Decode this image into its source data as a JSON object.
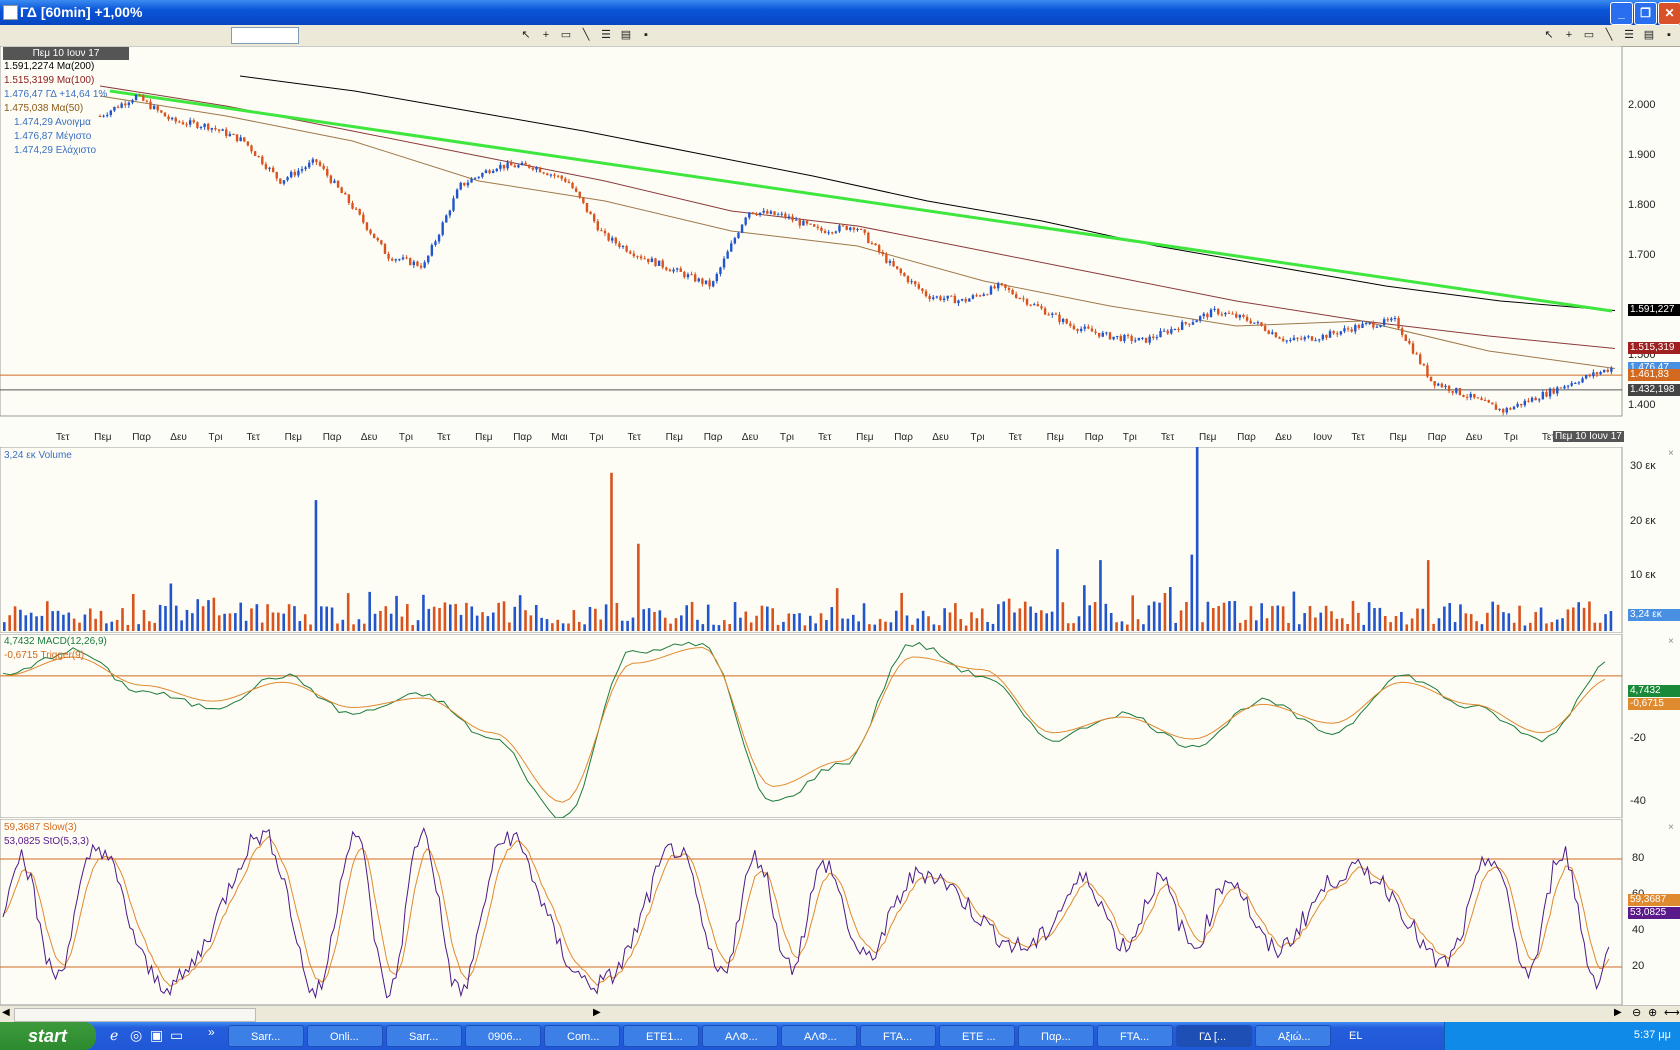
{
  "window": {
    "title": "ΓΔ [60min] +1,00%"
  },
  "price_panel": {
    "date_badge": "Πεμ 10 Ιουν 17",
    "legend": [
      {
        "text": "1.591,2274 Mα(200)",
        "color": "#000000"
      },
      {
        "text": "1.515,3199 Mα(100)",
        "color": "#8b1a1a"
      },
      {
        "text": "1.476,47 ΓΔ +14,64 1%",
        "color": "#3a6fc0"
      },
      {
        "text": "1.475,038 Mα(50)",
        "color": "#8b5a1a"
      },
      {
        "text": "1.474,29 Ανοιγμα",
        "color": "#3a6fc0"
      },
      {
        "text": "1.476,87 Μέγιστο",
        "color": "#3a6fc0"
      },
      {
        "text": "1.474,29 Ελάχιστο",
        "color": "#3a6fc0"
      }
    ],
    "y_ticks": [
      "2.000",
      "1.900",
      "1.800",
      "1.700",
      "1.500",
      "1.400"
    ],
    "price_tags": [
      {
        "text": "1.591,227",
        "color": "#000000"
      },
      {
        "text": "1.515,319",
        "color": "#a02020"
      },
      {
        "text": "1.476,47",
        "color": "#4a90e2"
      },
      {
        "text": "1.461,83",
        "color": "#d2691e"
      },
      {
        "text": "1.432,198",
        "color": "#444444"
      }
    ],
    "x_labels": [
      "Τετ",
      "Πεμ",
      "Παρ",
      "Δευ",
      "Τρι",
      "Τετ",
      "Πεμ",
      "Παρ",
      "Δευ",
      "Τρι",
      "Τετ",
      "Πεμ",
      "Παρ",
      "Μαι",
      "Τρι",
      "Τετ",
      "Πεμ",
      "Παρ",
      "Δευ",
      "Τρι",
      "Τετ",
      "Πεμ",
      "Παρ",
      "Δευ",
      "Τρι",
      "Τετ",
      "Πεμ",
      "Παρ",
      "Τρι",
      "Τετ",
      "Πεμ",
      "Παρ",
      "Δευ",
      "Ιουν",
      "Τετ",
      "Πεμ",
      "Παρ",
      "Δευ",
      "Τρι",
      "Τετ"
    ],
    "x_end_label": "Πεμ 10 Ιουν 17"
  },
  "volume_panel": {
    "legend": "3,24 εκ Volume",
    "y_ticks": [
      "30 εκ",
      "20 εκ",
      "10 εκ"
    ],
    "tag": "3,24 εκ"
  },
  "macd_panel": {
    "legend": [
      {
        "text": "4,7432 MACD(12,26,9)",
        "color": "#1a7a3a"
      },
      {
        "text": "-0,6715 Trigger(9)",
        "color": "#d2691e"
      }
    ],
    "y_ticks": [
      "-20",
      "-40"
    ],
    "tags": [
      {
        "text": "4,7432",
        "color": "#1a8a3a"
      },
      {
        "text": "-0,6715",
        "color": "#e08a30"
      }
    ]
  },
  "stoch_panel": {
    "legend": [
      {
        "text": "59,3687 Slow(3)",
        "color": "#d2691e"
      },
      {
        "text": "53,0825 StO(5,3,3)",
        "color": "#5a1a8a"
      }
    ],
    "y_ticks": [
      "80",
      "60",
      "40",
      "20"
    ],
    "tags": [
      {
        "text": "59,3687",
        "color": "#e08a30"
      },
      {
        "text": "53,0825",
        "color": "#5a1a8a"
      }
    ]
  },
  "toolbar": {
    "icons": [
      "pointer-icon",
      "crosshair-icon",
      "rectangle-icon",
      "line-icon",
      "properties-icon",
      "chart-icon",
      "save-icon"
    ]
  },
  "taskbar": {
    "start_label": "start",
    "tasks": [
      "Sarr...",
      "Onli...",
      "Sarr...",
      "0906...",
      "Com...",
      "ETE1...",
      "ΑΛΦ...",
      "ΑΛΦ...",
      "FTA...",
      "ETE ...",
      "Παρ...",
      "FTA...",
      "ΓΔ [...",
      "Αξιώ..."
    ],
    "active_task": 12,
    "lang": "EL",
    "clock": "5:37 μμ"
  },
  "chart_data": [
    {
      "type": "candlestick",
      "title": "ΓΔ [60min] +1,00%",
      "ylim": [
        1380,
        2100
      ],
      "series": [
        {
          "name": "Mα(200)",
          "values": [
            2060,
            2030,
            1990,
            1950,
            1905,
            1860,
            1810,
            1770,
            1720,
            1680,
            1640,
            1610,
            1591
          ]
        },
        {
          "name": "Mα(100)",
          "values": [
            2040,
            2000,
            1950,
            1900,
            1850,
            1790,
            1760,
            1710,
            1660,
            1610,
            1570,
            1540,
            1515
          ]
        },
        {
          "name": "Mα(50)",
          "values": [
            2020,
            1980,
            1930,
            1850,
            1810,
            1750,
            1720,
            1650,
            1600,
            1560,
            1570,
            1510,
            1475
          ]
        },
        {
          "name": "trendline",
          "values": [
            2030,
            1590
          ]
        }
      ],
      "last_close": 1476.47,
      "close_path": [
        1980,
        2020,
        1970,
        1960,
        1930,
        1850,
        1890,
        1800,
        1700,
        1680,
        1840,
        1880,
        1880,
        1850,
        1740,
        1700,
        1670,
        1640,
        1790,
        1780,
        1750,
        1760,
        1680,
        1620,
        1610,
        1640,
        1600,
        1560,
        1540,
        1530,
        1560,
        1590,
        1570,
        1530,
        1540,
        1560,
        1570,
        1450,
        1420,
        1390,
        1420,
        1450,
        1476
      ]
    },
    {
      "type": "bar",
      "title": "Volume",
      "ylim": [
        0,
        33
      ],
      "last_value": 3.24
    },
    {
      "type": "line",
      "title": "MACD(12,26,9)",
      "ylim": [
        -45,
        12
      ],
      "series": [
        {
          "name": "MACD(12,26,9)",
          "values": [
            0,
            8,
            -5,
            -10,
            0,
            -12,
            -6,
            -20,
            -45,
            8,
            10,
            -40,
            -28,
            10,
            0,
            -20,
            -12,
            -22,
            -8,
            -18,
            0,
            -10,
            -20,
            4.7432
          ]
        },
        {
          "name": "Trigger(9)",
          "values": [
            0,
            6,
            -3,
            -8,
            -2,
            -10,
            -7,
            -18,
            -40,
            4,
            9,
            -35,
            -27,
            6,
            2,
            -18,
            -13,
            -20,
            -9,
            -15,
            -2,
            -9,
            -18,
            -0.6715
          ]
        }
      ]
    },
    {
      "type": "line",
      "title": "Stochastic",
      "ylim": [
        0,
        100
      ],
      "series": [
        {
          "name": "StO(5,3,3)",
          "last": 53.0825
        },
        {
          "name": "Slow(3)",
          "last": 59.3687
        }
      ]
    }
  ]
}
